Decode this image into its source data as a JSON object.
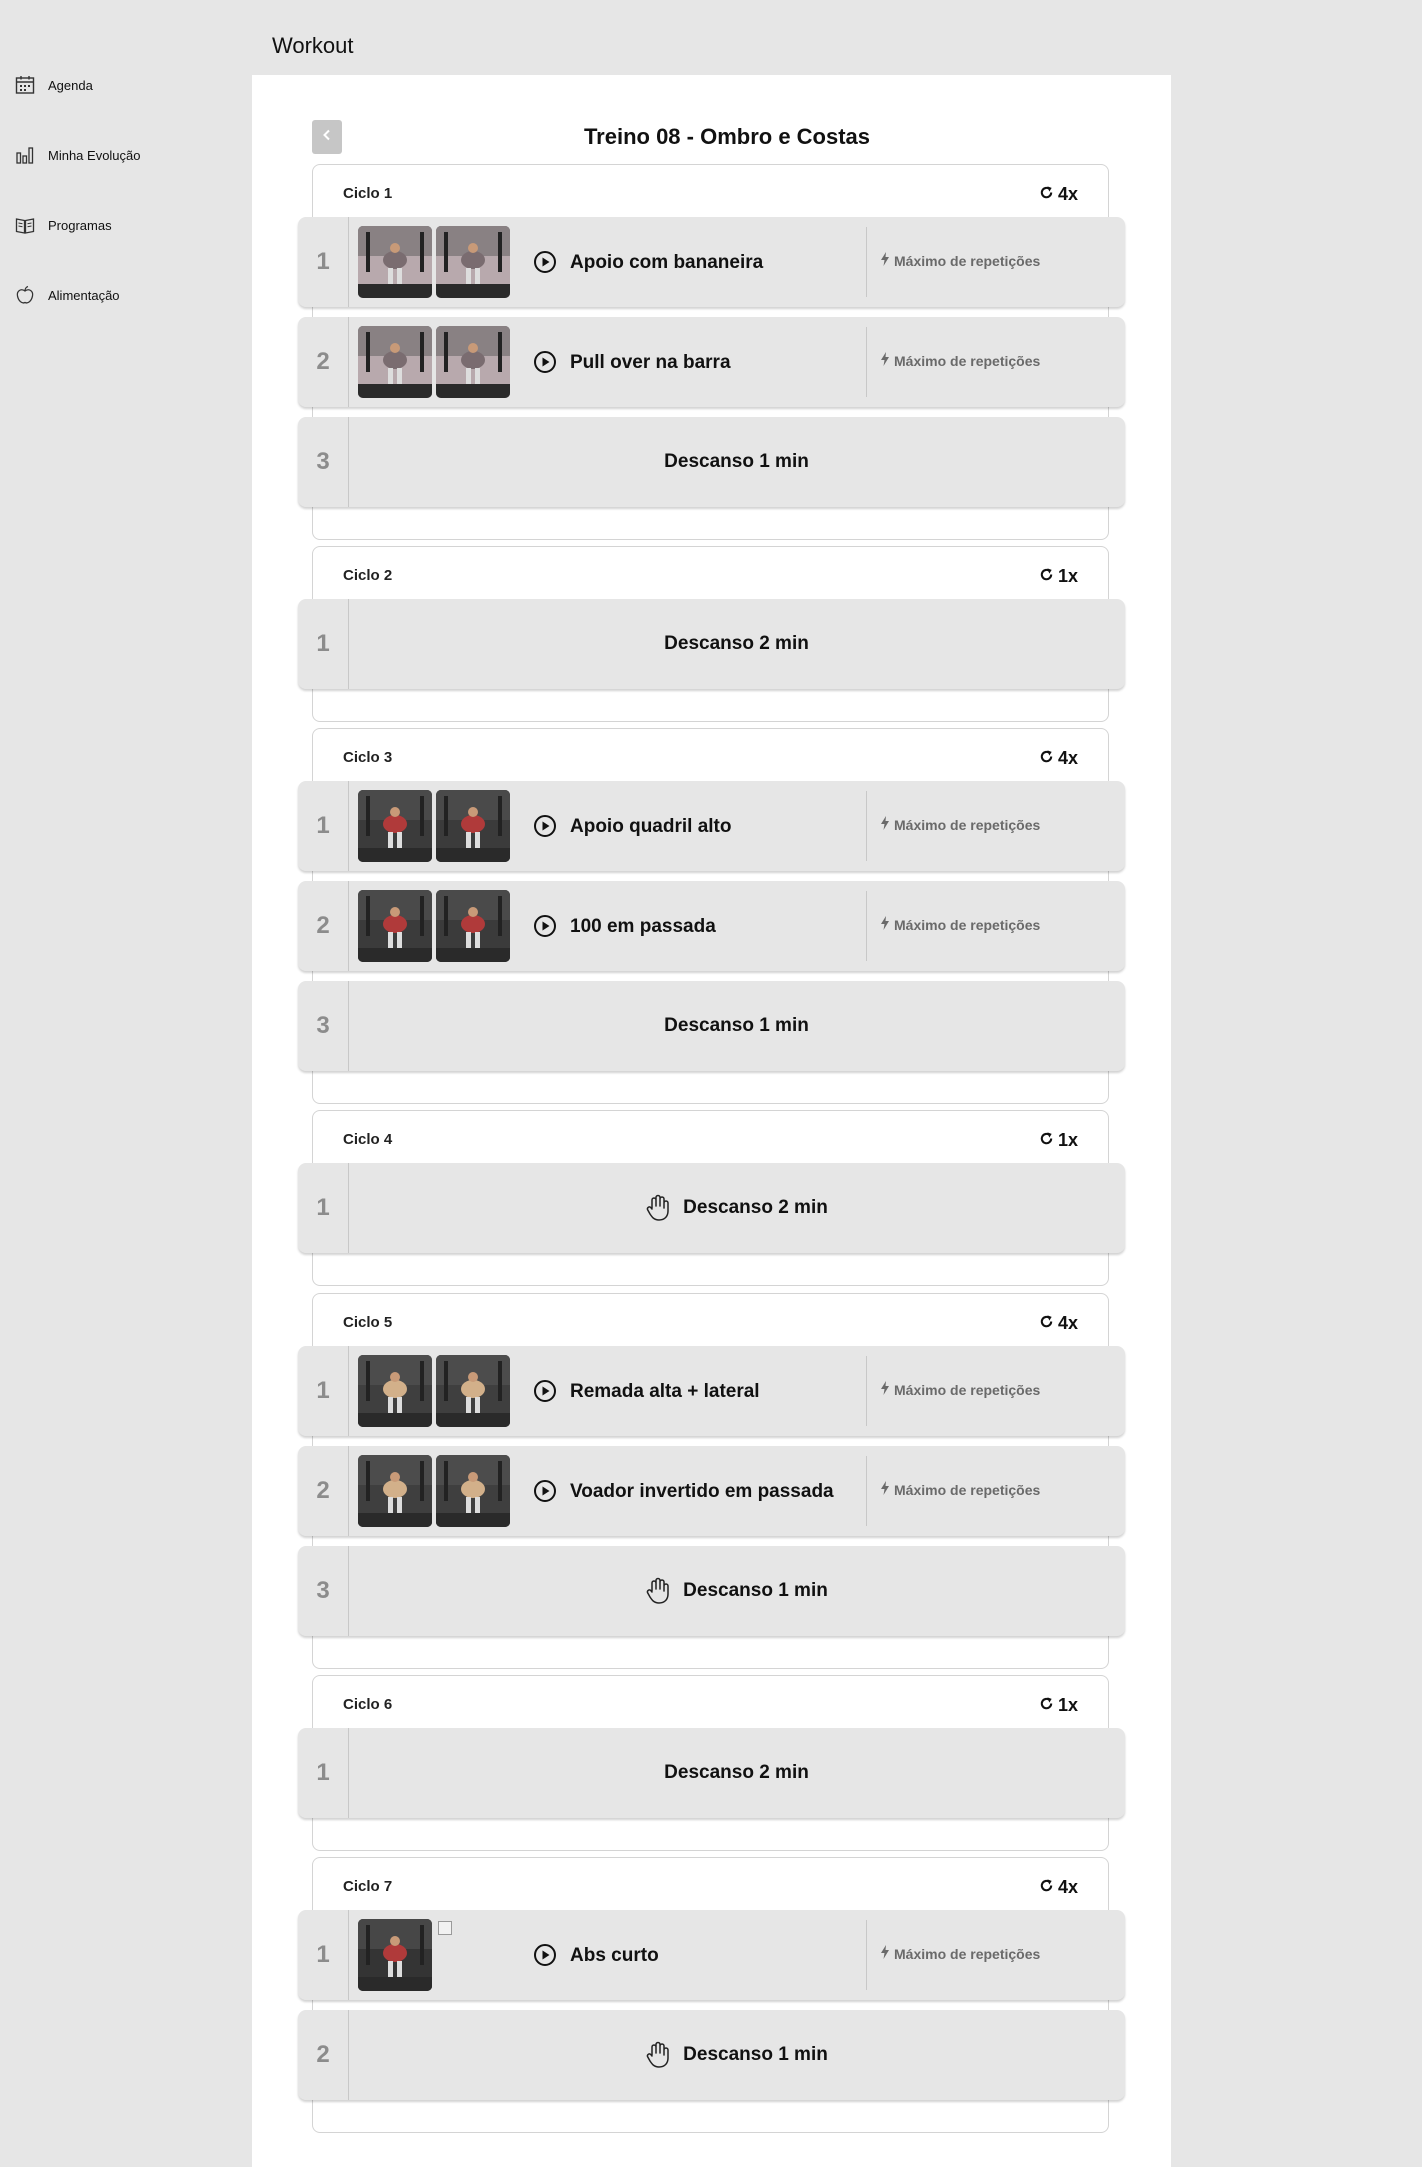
{
  "sidebar": {
    "items": [
      {
        "label": "Agenda",
        "icon": "calendar-icon"
      },
      {
        "label": "Minha Evolução",
        "icon": "bar-chart-icon"
      },
      {
        "label": "Programas",
        "icon": "book-icon"
      },
      {
        "label": "Alimentação",
        "icon": "apple-icon"
      }
    ]
  },
  "header": {
    "title": "Workout"
  },
  "workout": {
    "title": "Treino 08 - Ombro e Costas",
    "back_icon": "chevron-left-icon"
  },
  "cycles": [
    {
      "name": "Ciclo 1",
      "reps": "4x",
      "rows": [
        {
          "num": "1",
          "type": "exercise",
          "name": "Apoio com bananeira",
          "meta": "Máximo de repetições"
        },
        {
          "num": "2",
          "type": "exercise",
          "name": "Pull over na barra",
          "meta": "Máximo de repetições"
        },
        {
          "num": "3",
          "type": "rest",
          "text": "Descanso 1 min",
          "hand": false
        }
      ]
    },
    {
      "name": "Ciclo 2",
      "reps": "1x",
      "rows": [
        {
          "num": "1",
          "type": "rest",
          "text": "Descanso 2 min",
          "hand": false
        }
      ]
    },
    {
      "name": "Ciclo 3",
      "reps": "4x",
      "rows": [
        {
          "num": "1",
          "type": "exercise",
          "name": "Apoio quadril alto",
          "meta": "Máximo de repetições"
        },
        {
          "num": "2",
          "type": "exercise",
          "name": "100 em passada",
          "meta": "Máximo de repetições"
        },
        {
          "num": "3",
          "type": "rest",
          "text": "Descanso 1 min",
          "hand": false
        }
      ]
    },
    {
      "name": "Ciclo 4",
      "reps": "1x",
      "rows": [
        {
          "num": "1",
          "type": "rest",
          "text": "Descanso 2 min",
          "hand": true
        }
      ]
    },
    {
      "name": "Ciclo 5",
      "reps": "4x",
      "rows": [
        {
          "num": "1",
          "type": "exercise",
          "name": "Remada alta + lateral",
          "meta": "Máximo de repetições"
        },
        {
          "num": "2",
          "type": "exercise",
          "name": "Voador invertido em passada",
          "meta": "Máximo de repetições"
        },
        {
          "num": "3",
          "type": "rest",
          "text": "Descanso 1 min",
          "hand": true
        }
      ]
    },
    {
      "name": "Ciclo 6",
      "reps": "1x",
      "rows": [
        {
          "num": "1",
          "type": "rest",
          "text": "Descanso 2 min",
          "hand": false
        }
      ]
    },
    {
      "name": "Ciclo 7",
      "reps": "4x",
      "rows": [
        {
          "num": "1",
          "type": "exercise",
          "name": "Abs curto",
          "meta": "Máximo de repetições",
          "broken_second": true
        },
        {
          "num": "2",
          "type": "rest",
          "text": "Descanso 1 min",
          "hand": true
        }
      ]
    }
  ]
}
